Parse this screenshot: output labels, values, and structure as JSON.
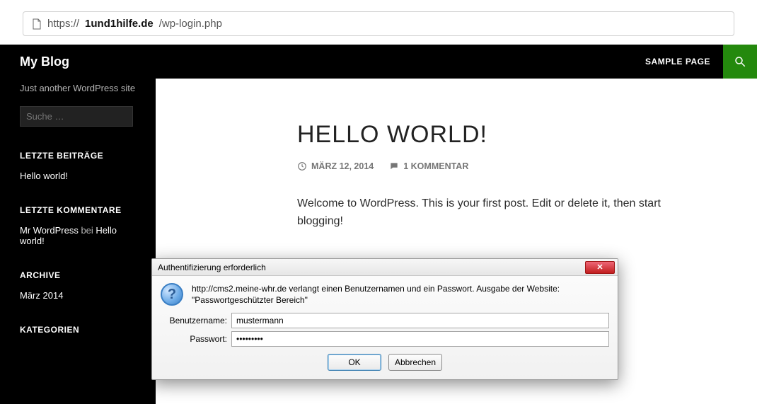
{
  "address_bar": {
    "url_scheme": "https://",
    "url_host_bold": "1und1hilfe.de",
    "url_path": "/wp-login.php"
  },
  "topbar": {
    "site_title": "My Blog",
    "nav_link": "SAMPLE PAGE"
  },
  "sidebar": {
    "tagline": "Just another WordPress site",
    "search_placeholder": "Suche …",
    "widget_recent_posts_title": "LETZTE BEITRÄGE",
    "recent_post": "Hello world!",
    "widget_recent_comments_title": "LETZTE KOMMENTARE",
    "comment_author": "Mr WordPress",
    "comment_joiner": " bei ",
    "comment_post": "Hello world!",
    "widget_archive_title": "ARCHIVE",
    "archive_item": "März 2014",
    "widget_categories_title": "KATEGORIEN"
  },
  "post": {
    "title": "HELLO WORLD!",
    "date": "MÄRZ 12, 2014",
    "comments": "1 KOMMENTAR",
    "body": "Welcome to WordPress. This is your first post. Edit or delete it, then start blogging!"
  },
  "dialog": {
    "title": "Authentifizierung erforderlich",
    "message": "http://cms2.meine-whr.de verlangt einen Benutzernamen und ein Passwort. Ausgabe der Website: \"Passwortgeschützter Bereich\"",
    "username_label": "Benutzername:",
    "username_value": "mustermann",
    "password_label": "Passwort:",
    "password_value": "•••••••••",
    "ok_label": "OK",
    "cancel_label": "Abbrechen",
    "close_glyph": "✕"
  }
}
